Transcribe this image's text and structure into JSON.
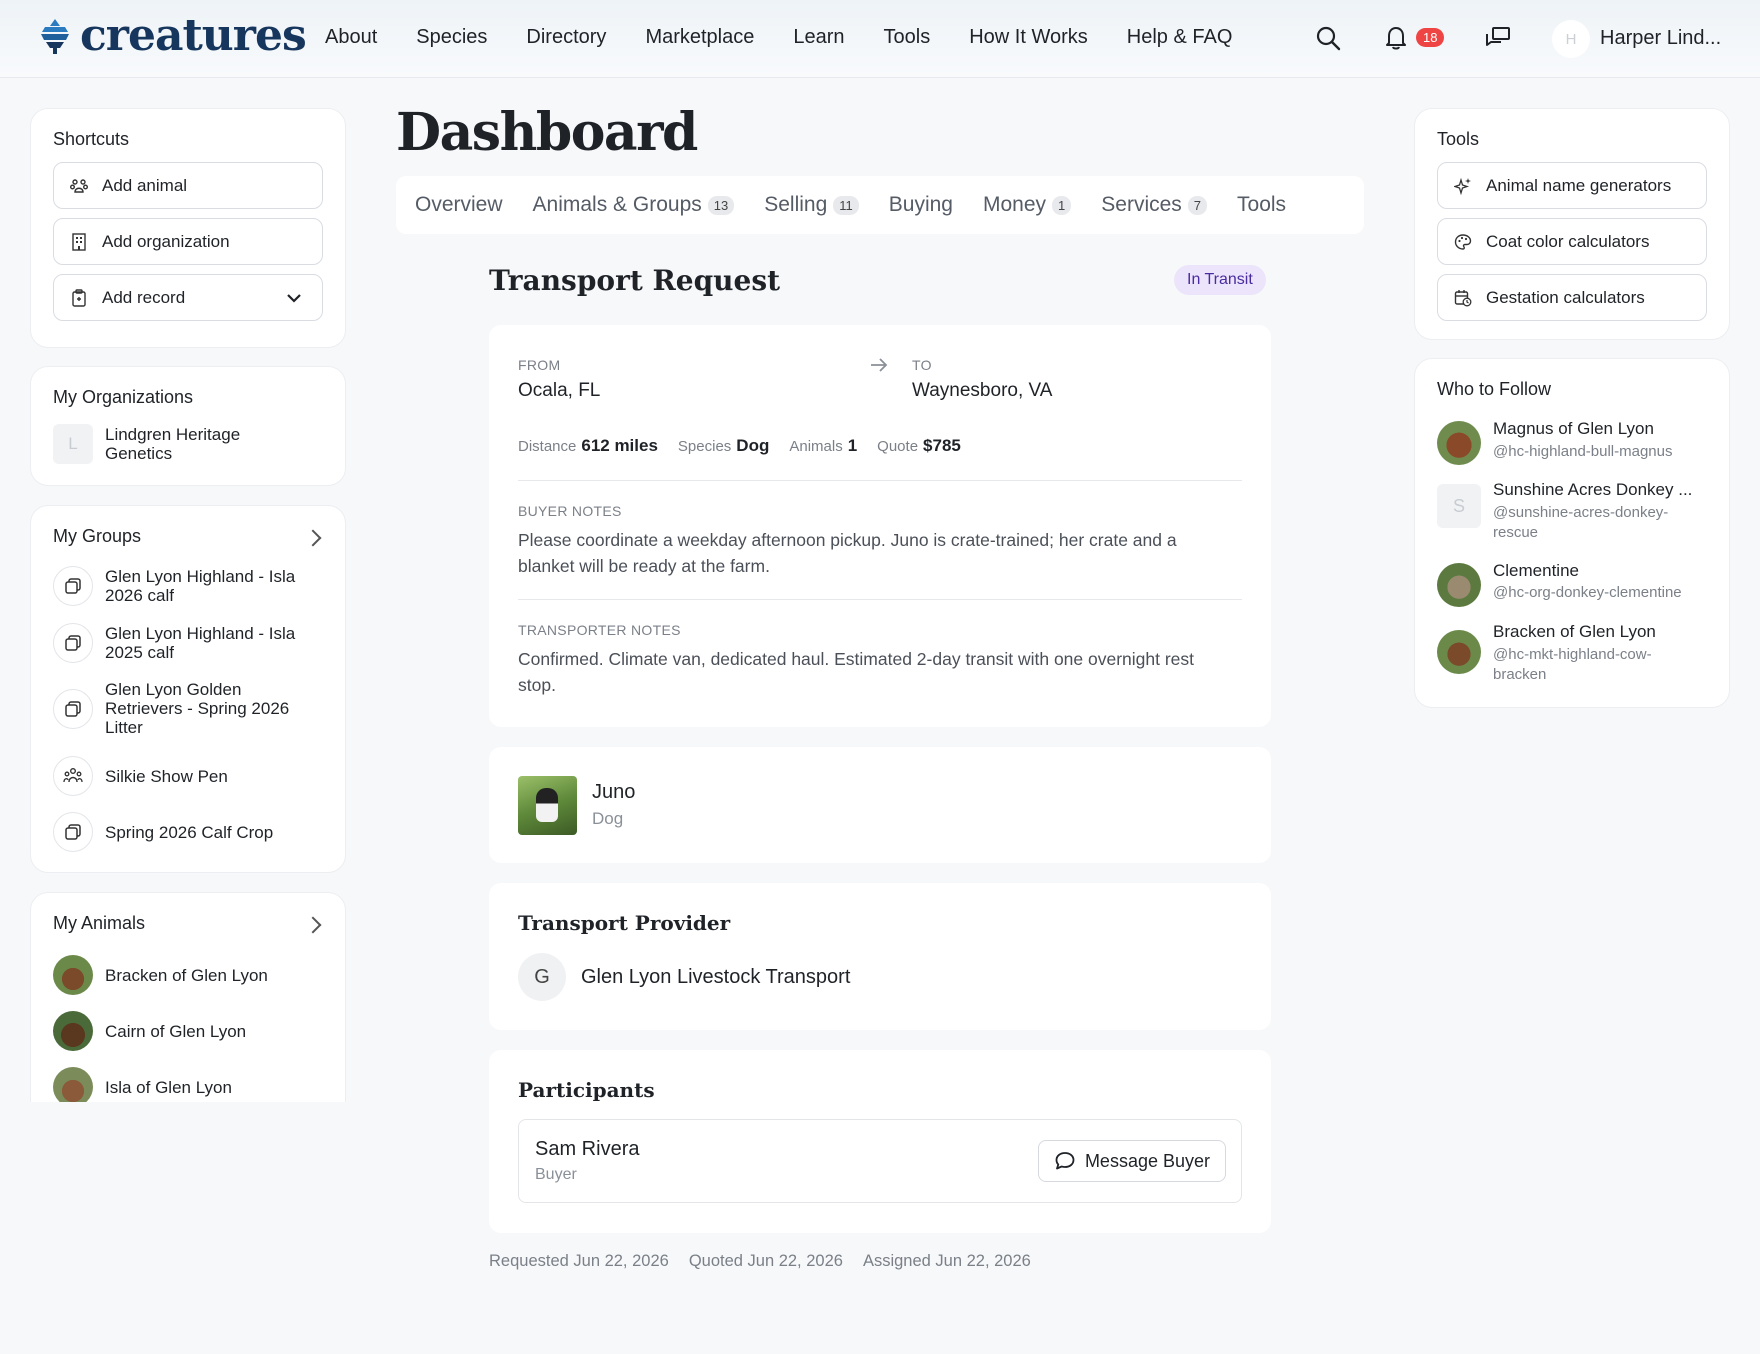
{
  "brand": {
    "name": "creatures"
  },
  "nav": [
    "About",
    "Species",
    "Directory",
    "Marketplace",
    "Learn",
    "Tools",
    "How It Works",
    "Help & FAQ"
  ],
  "header": {
    "notifications_count": "18",
    "avatar_initial": "H",
    "user_name": "Harper Lind..."
  },
  "shortcuts": {
    "title": "Shortcuts",
    "items": [
      "Add animal",
      "Add organization",
      "Add record"
    ]
  },
  "organizations": {
    "title": "My Organizations",
    "items": [
      {
        "initial": "L",
        "name": "Lindgren Heritage Genetics"
      }
    ]
  },
  "groups": {
    "title": "My Groups",
    "items": [
      "Glen Lyon Highland - Isla 2026 calf",
      "Glen Lyon Highland - Isla 2025 calf",
      "Glen Lyon Golden Retrievers - Spring 2026 Litter",
      "Silkie Show Pen",
      "Spring 2026 Calf Crop"
    ]
  },
  "animals": {
    "title": "My Animals",
    "items": [
      "Bracken of Glen Lyon",
      "Cairn of Glen Lyon",
      "Isla of Glen Lyon"
    ]
  },
  "page": {
    "title": "Dashboard"
  },
  "tabs": [
    {
      "label": "Overview",
      "count": ""
    },
    {
      "label": "Animals & Groups",
      "count": "13"
    },
    {
      "label": "Selling",
      "count": "11"
    },
    {
      "label": "Buying",
      "count": ""
    },
    {
      "label": "Money",
      "count": "1"
    },
    {
      "label": "Services",
      "count": "7"
    },
    {
      "label": "Tools",
      "count": ""
    }
  ],
  "transport": {
    "title": "Transport Request",
    "status": "In Transit",
    "from_label": "FROM",
    "from": "Ocala, FL",
    "to_label": "TO",
    "to": "Waynesboro, VA",
    "distance_label": "Distance",
    "distance": "612 miles",
    "species_label": "Species",
    "species": "Dog",
    "animals_label": "Animals",
    "animals": "1",
    "quote_label": "Quote",
    "quote": "$785",
    "buyer_notes_label": "BUYER NOTES",
    "buyer_notes": "Please coordinate a weekday afternoon pickup. Juno is crate-trained; her crate and a blanket will be ready at the farm.",
    "transporter_notes_label": "TRANSPORTER NOTES",
    "transporter_notes": "Confirmed. Climate van, dedicated haul. Estimated 2-day transit with one overnight rest stop."
  },
  "animal": {
    "name": "Juno",
    "species": "Dog"
  },
  "provider": {
    "title": "Transport Provider",
    "initial": "G",
    "name": "Glen Lyon Livestock Transport"
  },
  "participants": {
    "title": "Participants",
    "name": "Sam Rivera",
    "role": "Buyer",
    "message_label": "Message Buyer"
  },
  "footer": {
    "requested": "Requested Jun 22, 2026",
    "quoted": "Quoted Jun 22, 2026",
    "assigned": "Assigned Jun 22, 2026"
  },
  "tools": {
    "title": "Tools",
    "items": [
      "Animal name generators",
      "Coat color calculators",
      "Gestation calculators"
    ]
  },
  "follow": {
    "title": "Who to Follow",
    "items": [
      {
        "name": "Magnus of Glen Lyon",
        "handle": "@hc-highland-bull-magnus"
      },
      {
        "name": "Sunshine Acres Donkey ...",
        "handle": "@sunshine-acres-donkey-rescue",
        "initial": "S"
      },
      {
        "name": "Clementine",
        "handle": "@hc-org-donkey-clementine"
      },
      {
        "name": "Bracken of Glen Lyon",
        "handle": "@hc-mkt-highland-cow-bracken"
      }
    ]
  }
}
